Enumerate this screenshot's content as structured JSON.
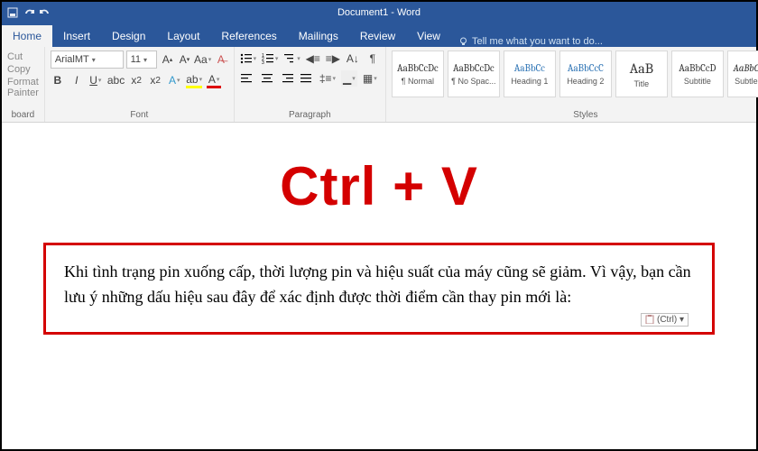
{
  "titlebar": {
    "doc": "Document1 - Word"
  },
  "tabs": {
    "items": [
      "Home",
      "Insert",
      "Design",
      "Layout",
      "References",
      "Mailings",
      "Review",
      "View"
    ],
    "active": 0,
    "tell": "Tell me what you want to do..."
  },
  "clipboard": {
    "cut": "Cut",
    "copy": "Copy",
    "fp": "Format Painter",
    "group": "board"
  },
  "font": {
    "name": "ArialMT",
    "size": "11",
    "group": "Font"
  },
  "para": {
    "group": "Paragraph"
  },
  "styles": {
    "items": [
      {
        "sample": "AaBbCcDc",
        "name": "¶ Normal"
      },
      {
        "sample": "AaBbCcDc",
        "name": "¶ No Spac..."
      },
      {
        "sample": "AaBbCc",
        "name": "Heading 1"
      },
      {
        "sample": "AaBbCcC",
        "name": "Heading 2"
      },
      {
        "sample": "AaB",
        "name": "Title"
      },
      {
        "sample": "AaBbCcD",
        "name": "Subtitle"
      },
      {
        "sample": "AaBbCcDc",
        "name": "Subtle Em"
      }
    ],
    "group": "Styles"
  },
  "overlay": {
    "shortcut": "Ctrl + V"
  },
  "content": {
    "text": "Khi tình trạng pin xuống cấp, thời lượng pin và hiệu suất của máy cũng sẽ giảm. Vì vậy, bạn cần lưu ý những dấu hiệu sau đây để xác định được thời điểm cần thay pin mới là:"
  },
  "smarttag": {
    "label": "(Ctrl) ▾"
  }
}
